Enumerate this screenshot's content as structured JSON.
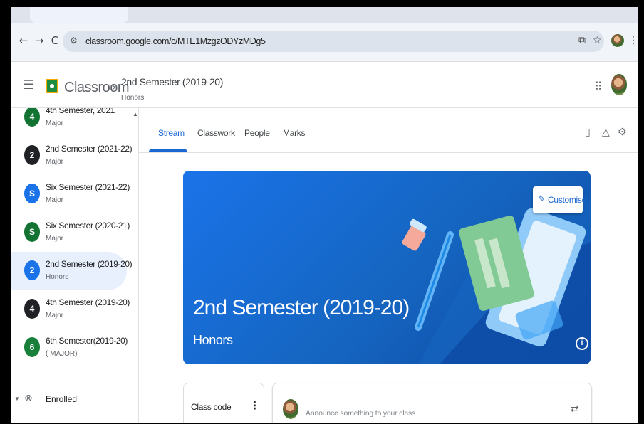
{
  "browser": {
    "url": "classroom.google.com/c/MTE1MzgzODYzMDg5",
    "back_icon": "←",
    "forward_icon": "→",
    "reload_icon": "C",
    "site_settings_icon": "⚙",
    "install_icon": "⧉",
    "star_icon": "☆",
    "menu_icon": "⋮"
  },
  "header": {
    "app_name": "Classroom",
    "breadcrumb_separator": "›",
    "class_title": "2nd Semester (2019-20)",
    "class_section": "Honors",
    "hamburger_icon": "☰",
    "apps_icon": "⠿"
  },
  "sidebar": {
    "items": [
      {
        "badge": "4",
        "title": "4th Semester, 2021",
        "subtitle": "Major",
        "color": "#137333"
      },
      {
        "badge": "2",
        "title": "2nd Semester (2021-22)",
        "subtitle": "Major",
        "color": "#202124"
      },
      {
        "badge": "S",
        "title": "Six Semester (2021-22)",
        "subtitle": "Major",
        "color": "#1a73e8"
      },
      {
        "badge": "S",
        "title": "Six Semester (2020-21)",
        "subtitle": "Major",
        "color": "#137333"
      },
      {
        "badge": "2",
        "title": "2nd Semester (2019-20)",
        "subtitle": "Honors",
        "color": "#1a73e8"
      },
      {
        "badge": "4",
        "title": "4th Semester (2019-20)",
        "subtitle": "Major",
        "color": "#202124"
      },
      {
        "badge": "6",
        "title": "6th Semester(2019-20)",
        "subtitle": "( MAJOR)",
        "color": "#188038"
      }
    ],
    "enrolled_label": "Enrolled",
    "enrolled_caret": "▼",
    "enrolled_icon": "⊗",
    "scroll_up": "▲"
  },
  "tabs": {
    "items": [
      "Stream",
      "Classwork",
      "People",
      "Marks"
    ],
    "active": "Stream",
    "calendar_icon": "▯",
    "drive_icon": "△",
    "settings_icon": "⚙"
  },
  "banner": {
    "title": "2nd Semester (2019-20)",
    "subtitle": "Honors",
    "customise_label": "Customise",
    "pen_icon": "✎",
    "info_icon": "i"
  },
  "class_code_card": {
    "label": "Class code",
    "more_icon": "⋮"
  },
  "announce": {
    "placeholder": "Announce something to your class",
    "repost_icon": "⇄"
  }
}
